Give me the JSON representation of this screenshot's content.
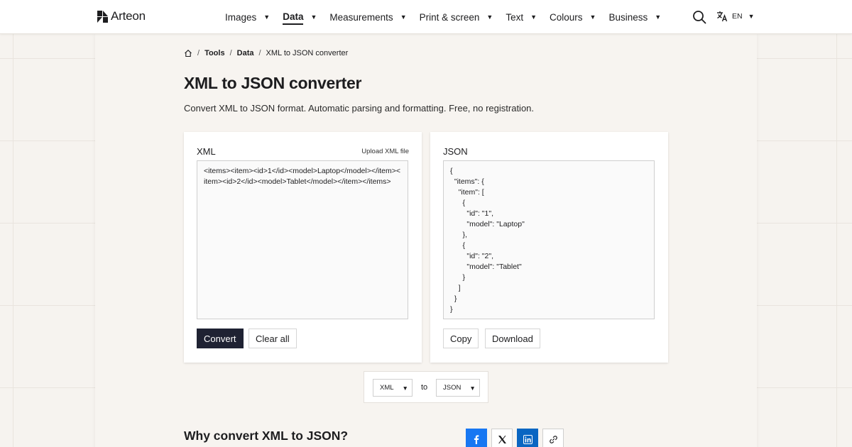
{
  "header": {
    "logo_text": "Arteon",
    "nav": [
      {
        "label": "Images",
        "active": false
      },
      {
        "label": "Data",
        "active": true
      },
      {
        "label": "Measurements",
        "active": false
      },
      {
        "label": "Print & screen",
        "active": false
      },
      {
        "label": "Text",
        "active": false
      },
      {
        "label": "Colours",
        "active": false
      },
      {
        "label": "Business",
        "active": false
      }
    ],
    "search_icon": "search-icon",
    "language_code": "EN"
  },
  "breadcrumb": {
    "items": [
      "Tools",
      "Data"
    ],
    "current": "XML to JSON converter"
  },
  "page": {
    "title": "XML to JSON converter",
    "subtitle": "Convert XML to JSON format. Automatic parsing and formatting. Free, no registration."
  },
  "input_panel": {
    "label": "XML",
    "upload_label": "Upload XML file",
    "value": "<items><item><id>1</id><model>Laptop</model></item><item><id>2</id><model>Tablet</model></item></items>",
    "convert_label": "Convert",
    "clear_label": "Clear all"
  },
  "output_panel": {
    "label": "JSON",
    "value": "{\n  \"items\": {\n    \"item\": [\n      {\n        \"id\": \"1\",\n        \"model\": \"Laptop\"\n      },\n      {\n        \"id\": \"2\",\n        \"model\": \"Tablet\"\n      }\n    ]\n  }\n}",
    "copy_label": "Copy",
    "download_label": "Download"
  },
  "format_bar": {
    "from": "XML",
    "to_label": "to",
    "to": "JSON"
  },
  "why_section": {
    "title": "Why convert XML to JSON?"
  },
  "share_icons": [
    "facebook-icon",
    "x-icon",
    "linkedin-icon",
    "link-icon"
  ],
  "colors": {
    "primary_button": "#1f2233",
    "facebook": "#1877f2",
    "linkedin": "#0a66c2",
    "background": "#f6f3ef"
  }
}
